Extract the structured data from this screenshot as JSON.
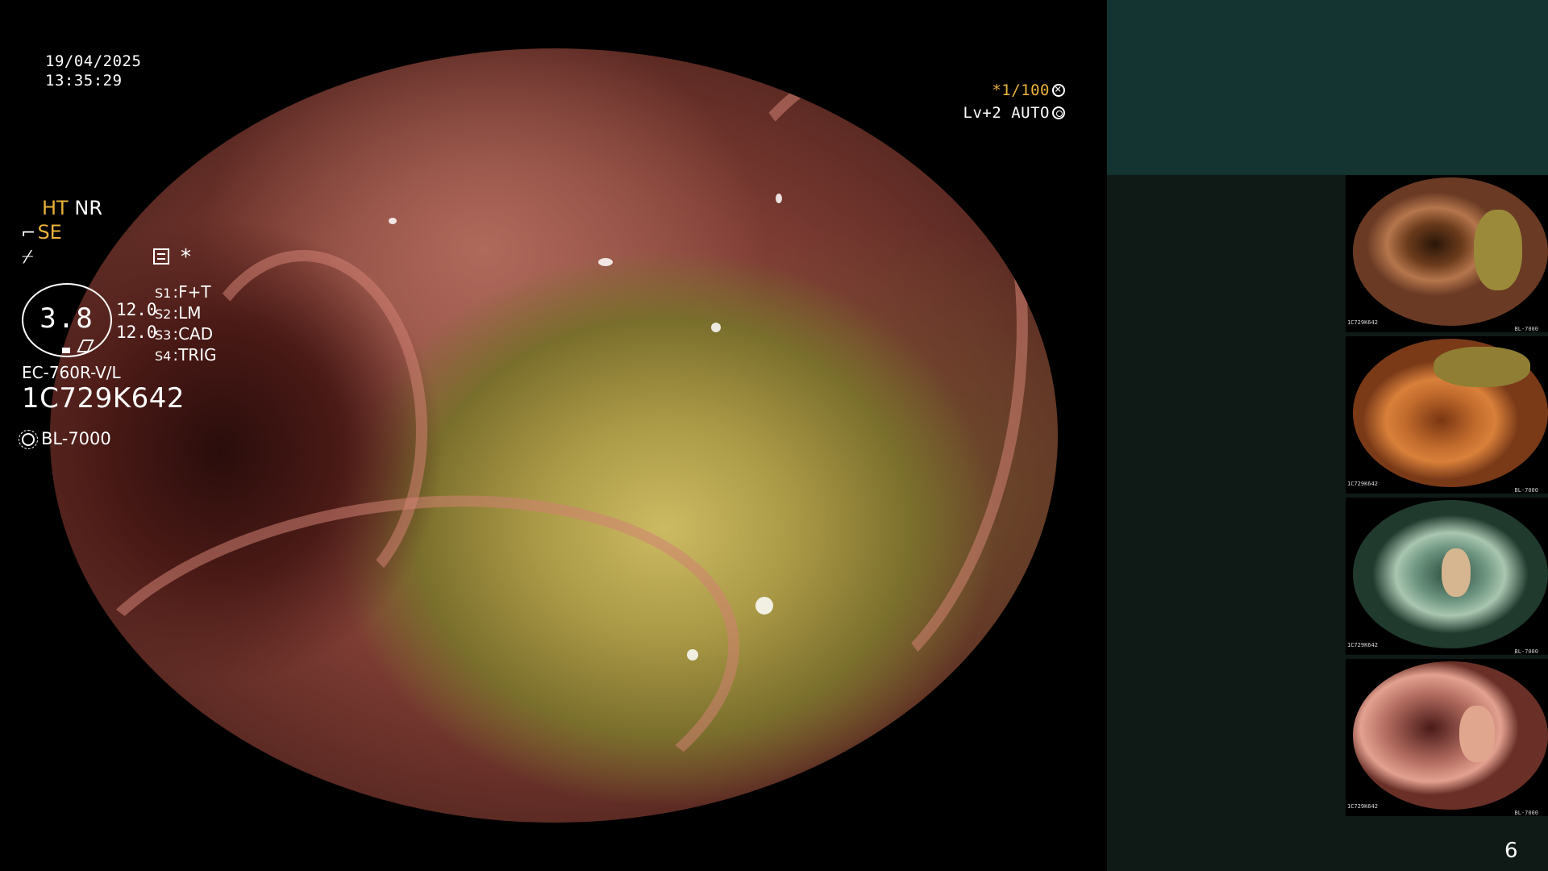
{
  "overlay": {
    "date": "19/04/2025",
    "time": "13:35:29",
    "shutter": "*1/100",
    "level": "Lv+2 AUTO"
  },
  "panel": {
    "ht_label": "HT",
    "nr_label": "NR",
    "se_label": "SE",
    "star": "*",
    "gauge_value": "3.8",
    "gain_1": "12.0",
    "gain_2": "12.0",
    "switches": [
      {
        "key": "S1",
        "value": "F+T"
      },
      {
        "key": "S2",
        "value": "LM"
      },
      {
        "key": "S3",
        "value": "CAD"
      },
      {
        "key": "S4",
        "value": "TRIG"
      }
    ],
    "model": "EC-760R-V/L",
    "serial": "1C729K642",
    "light_source": "BL-7000"
  },
  "thumbnails": [
    {
      "serial": "1C729K642",
      "light": "BL-7000"
    },
    {
      "serial": "1C729K642",
      "light": "BL-7000"
    },
    {
      "serial": "1C729K642",
      "light": "BL-7000"
    },
    {
      "serial": "1C729K642",
      "light": "BL-7000"
    }
  ],
  "page_number": "6",
  "colors": {
    "accent": "#e9b23c",
    "panel_header": "#133430",
    "panel_body": "#0f1a17"
  },
  "icons": {
    "shutter": "fan-icon",
    "auto": "gear-icon",
    "scope": "scope-icon",
    "freeze": "freeze-icon",
    "menu": "menu-icon",
    "light": "sun-icon"
  }
}
